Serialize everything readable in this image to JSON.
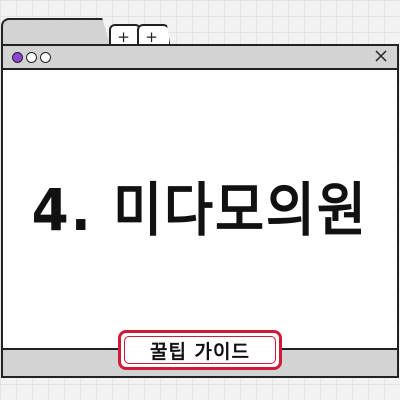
{
  "tabs": [
    {
      "label": "+"
    },
    {
      "label": "+"
    }
  ],
  "window": {
    "close_glyph": "×",
    "dots": [
      {
        "color": "#8e46d8"
      },
      {
        "color": "#ffffff"
      },
      {
        "color": "#ffffff"
      }
    ]
  },
  "main": {
    "headline": "4. 미다모의원"
  },
  "badge": {
    "label": "꿀팁 가이드",
    "border_color": "#d11a3a"
  },
  "icons": [
    "plus-icon",
    "plus-icon",
    "close-icon"
  ]
}
